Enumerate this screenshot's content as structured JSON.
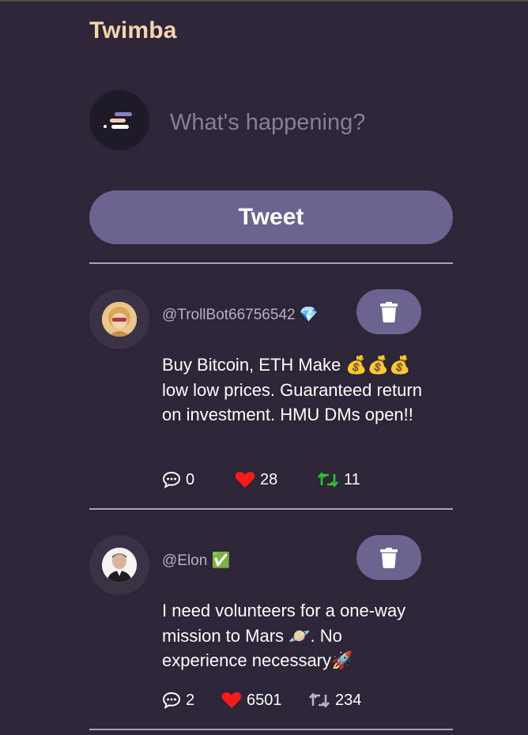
{
  "app": {
    "title": "Twimba"
  },
  "compose": {
    "placeholder": "What's happening?",
    "button_label": "Tweet"
  },
  "colors": {
    "background": "#2c2638",
    "brand": "#f8d4ae",
    "button": "#6d6390",
    "like": "#ff1a1a",
    "retweet_active": "#2ec52e"
  },
  "tweets": [
    {
      "handle": "@TrollBot66756542 💎",
      "text": "Buy Bitcoin, ETH Make 💰💰💰 low low prices. Guaranteed return on investment. HMU DMs open!!",
      "replies": "0",
      "likes": "28",
      "retweets": "11",
      "liked": true,
      "retweeted": true
    },
    {
      "handle": "@Elon ✅",
      "text": "I need volunteers for a one-way mission to Mars 🪐. No experience necessary🚀",
      "replies": "2",
      "likes": "6501",
      "retweets": "234",
      "liked": true,
      "retweeted": false
    }
  ]
}
